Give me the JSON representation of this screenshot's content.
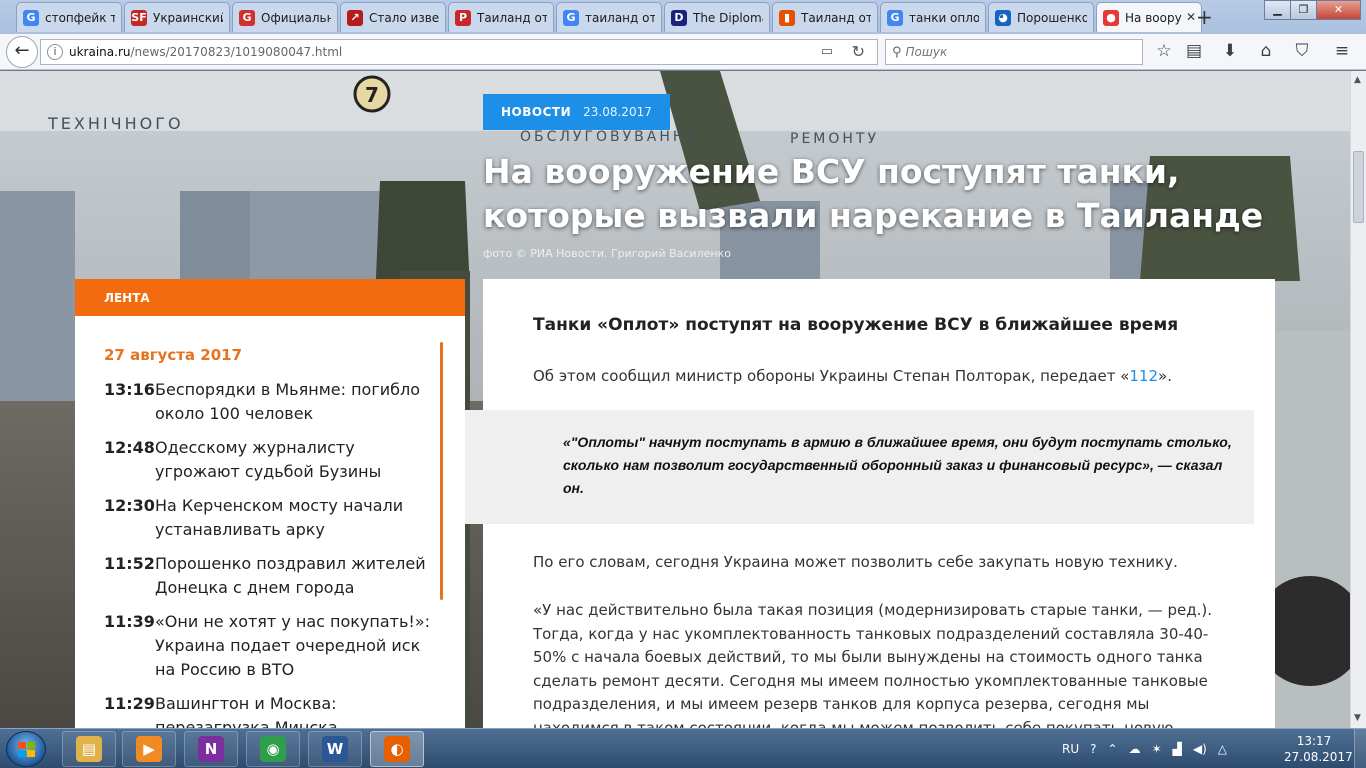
{
  "browser": {
    "tabs": [
      {
        "title": "стопфейк та",
        "icon": "google-icon",
        "icon_text": "G",
        "icon_color": "#4285f4"
      },
      {
        "title": "Украинский",
        "icon": "sf-icon",
        "icon_text": "SF",
        "icon_color": "#c62828"
      },
      {
        "title": "Официальн",
        "icon": "g-red-icon",
        "icon_text": "G",
        "icon_color": "#d32f2f"
      },
      {
        "title": "Стало извес",
        "icon": "trend-icon",
        "icon_text": "↗",
        "icon_color": "#b71c1c"
      },
      {
        "title": "Таиланд отк",
        "icon": "p-icon",
        "icon_text": "P",
        "icon_color": "#c62828"
      },
      {
        "title": "таиланд отк",
        "icon": "google-icon",
        "icon_text": "G",
        "icon_color": "#4285f4"
      },
      {
        "title": "The Diploma",
        "icon": "diplomat-icon",
        "icon_text": "D",
        "icon_color": "#1a237e"
      },
      {
        "title": "Таиланд отк",
        "icon": "ribbon-icon",
        "icon_text": "▮",
        "icon_color": "#e65100"
      },
      {
        "title": "танки оплот",
        "icon": "google-icon",
        "icon_text": "G",
        "icon_color": "#4285f4"
      },
      {
        "title": "Порошенко",
        "icon": "globe-icon",
        "icon_text": "◕",
        "icon_color": "#1565c0"
      },
      {
        "title": "На воору",
        "icon": "ukraina-icon",
        "icon_text": "●",
        "icon_color": "#e53935"
      }
    ],
    "url_host": "ukraina.ru",
    "url_path": "/news/20170823/1019080047.html",
    "search_placeholder": "Пошук"
  },
  "article": {
    "category": "НОВОСТИ",
    "date": "23.08.2017",
    "headline_line1": "На вооружение ВСУ поступят танки,",
    "headline_line2": "которые вызвали нарекание в Таиланде",
    "photo_credit": "фото © РИА Новости. Григорий Василенко",
    "subtitle": "Танки «Оплот» поступят на вооружение ВСУ в ближайшее время",
    "p1_before": "Об этом сообщил министр обороны Украины Степан Полторак, передает «",
    "p1_link": "112",
    "p1_after": "».",
    "quote": "«\"Оплоты\" начнут поступать в армию в ближайшее время, они будут поступать столько, сколько нам позволит государственный оборонный заказ и финансовый ресурс», — сказал он.",
    "p2": "По его словам, сегодня Украина может позволить себе закупать новую технику.",
    "p3": "«У нас действительно была такая позиция (модернизировать старые танки, — ред.). Тогда, когда у нас укомплектованность танковых подразделений составляла 30-40-50% с начала боевых действий, то мы были вынуждены на стоимость одного танка сделать ремонт десяти. Сегодня мы имеем полностью укомплектованные танковые подразделения, и мы имеем резерв танков для корпуса резерва,  сегодня мы находимся в таком состоянии, когда мы можем позволить себе покупать новую"
  },
  "background_signs": {
    "sign_number": "7",
    "word1": "ТЕХНІЧНОГО",
    "word2": "ОБСЛУГОВУВАННЯ",
    "word3": "РЕМОНТУ"
  },
  "feed": {
    "header": "ЛЕНТА",
    "date": "27 августа 2017",
    "items": [
      {
        "time": "13:16",
        "title": "Беспорядки в Мьянме: погибло около 100 человек"
      },
      {
        "time": "12:48",
        "title": "Одесскому журналисту угрожают судьбой Бузины"
      },
      {
        "time": "12:30",
        "title": "На Керченском мосту начали устанавливать арку"
      },
      {
        "time": "11:52",
        "title": "Порошенко поздравил жителей Донецка с днем города"
      },
      {
        "time": "11:39",
        "title": "«Они не хотят у нас покупать!»: Украина подает очередной иск на Россию в ВТО"
      },
      {
        "time": "11:29",
        "title": "Вашингтон и Москва: перезагрузка Минска"
      }
    ]
  },
  "taskbar": {
    "apps": [
      {
        "name": "explorer",
        "icon": "folder-icon",
        "icon_text": "▤",
        "color": "#e0b24a"
      },
      {
        "name": "media-player",
        "icon": "media-player-icon",
        "icon_text": "▶",
        "color": "#f08a24"
      },
      {
        "name": "onenote",
        "icon": "onenote-icon",
        "icon_text": "N",
        "color": "#7b2f9e"
      },
      {
        "name": "chrome",
        "icon": "chrome-icon",
        "icon_text": "◉",
        "color": "#2e9e4a"
      },
      {
        "name": "word",
        "icon": "word-icon",
        "icon_text": "W",
        "color": "#2b5797"
      },
      {
        "name": "firefox",
        "icon": "firefox-icon",
        "icon_text": "◐",
        "color": "#e66000"
      }
    ],
    "lang": "RU",
    "time": "13:17",
    "date": "27.08.2017"
  }
}
